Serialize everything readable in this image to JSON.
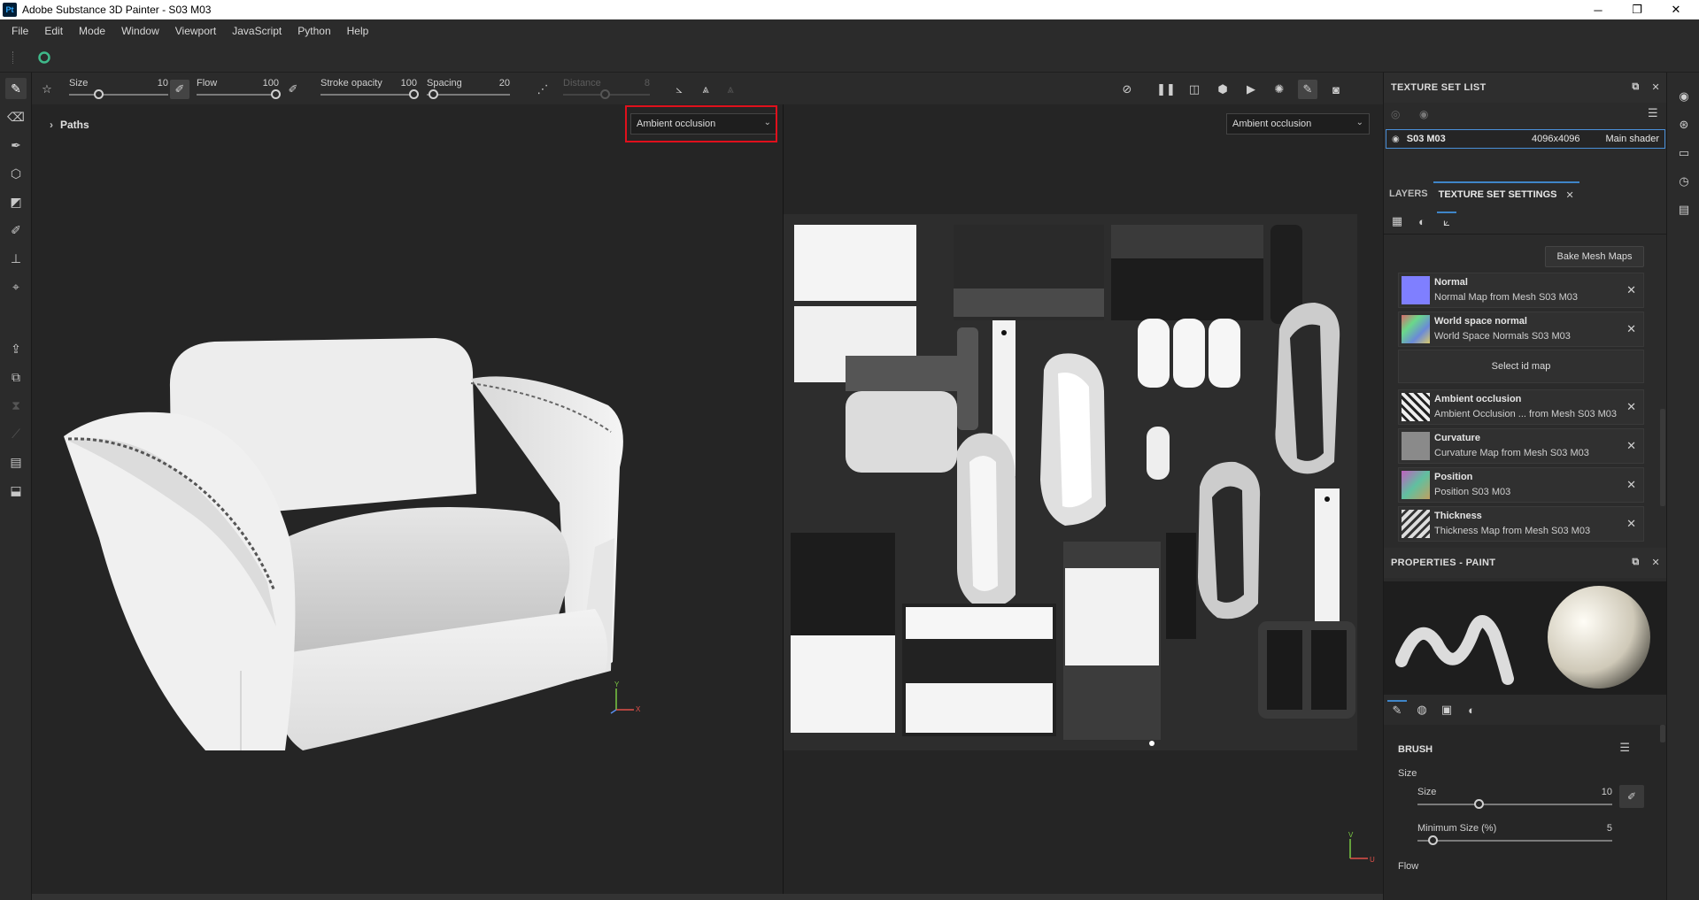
{
  "window": {
    "app_badge": "Pt",
    "title": "Adobe Substance 3D Painter - S03 M03",
    "controls": [
      "─",
      "❐",
      "✕"
    ]
  },
  "menu": [
    "File",
    "Edit",
    "Mode",
    "Window",
    "Viewport",
    "JavaScript",
    "Python",
    "Help"
  ],
  "tool_properties": {
    "size": {
      "label": "Size",
      "value": "10"
    },
    "flow": {
      "label": "Flow",
      "value": "100"
    },
    "stroke_opacity": {
      "label": "Stroke opacity",
      "value": "100"
    },
    "spacing": {
      "label": "Spacing",
      "value": "20"
    },
    "distance": {
      "label": "Distance",
      "value": "8"
    }
  },
  "viewport3d": {
    "paths_label": "Paths",
    "channel_dropdown": "Ambient occlusion",
    "axis_y": "Y",
    "axis_x": "X"
  },
  "viewport2d": {
    "channel_dropdown": "Ambient occlusion",
    "axis_v": "V",
    "axis_u": "U"
  },
  "texture_set_list": {
    "title": "TEXTURE SET LIST",
    "row": {
      "name": "S03 M03",
      "resolution": "4096x4096",
      "shader": "Main shader"
    }
  },
  "tabs": {
    "layers": "LAYERS",
    "texture_set_settings": "TEXTURE SET SETTINGS",
    "close": "✕"
  },
  "mesh_maps": {
    "bake_button": "Bake Mesh Maps",
    "select_id": "Select id map",
    "items": [
      {
        "name": "Normal",
        "source": "Normal Map from Mesh S03 M03",
        "thumb_color": "#7f7fff"
      },
      {
        "name": "World space normal",
        "source": "World Space Normals S03 M03",
        "thumb_color": "#c86a8a"
      },
      {
        "name": "Ambient occlusion",
        "source": "Ambient Occlusion ... from Mesh S03 M03",
        "thumb_color": "#e0e0e0"
      },
      {
        "name": "Curvature",
        "source": "Curvature Map from Mesh S03 M03",
        "thumb_color": "#8a8a8a"
      },
      {
        "name": "Position",
        "source": "Position S03 M03",
        "thumb_color": "#9a6ab0"
      },
      {
        "name": "Thickness",
        "source": "Thickness Map from Mesh S03 M03",
        "thumb_color": "#d8d8d8"
      }
    ]
  },
  "properties": {
    "title": "PROPERTIES - PAINT",
    "brush_header": "BRUSH",
    "size_group": "Size",
    "size": {
      "label": "Size",
      "value": "10"
    },
    "min_size": {
      "label": "Minimum Size (%)",
      "value": "5"
    },
    "flow_group": "Flow"
  }
}
